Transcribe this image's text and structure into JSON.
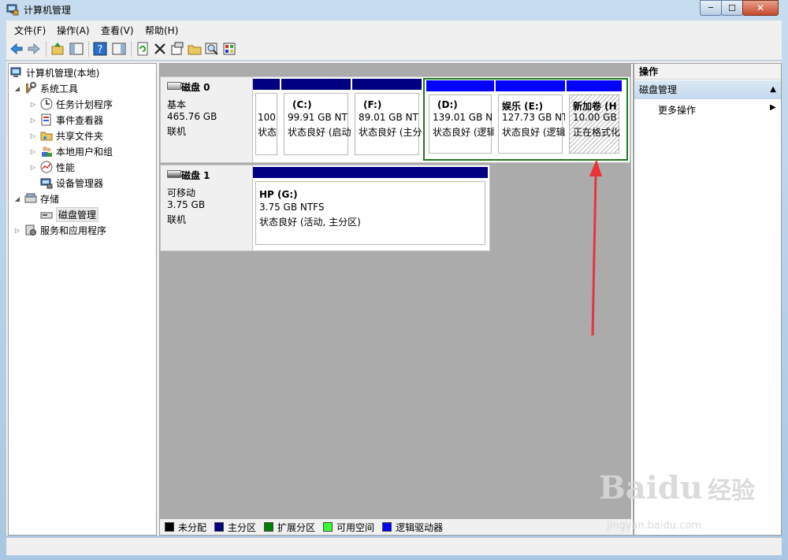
{
  "window": {
    "title": "计算机管理",
    "controls": {
      "minimize": "─",
      "maximize": "☐",
      "close": "✕"
    }
  },
  "menubar": {
    "items": [
      "文件(F)",
      "操作(A)",
      "查看(V)",
      "帮助(H)"
    ]
  },
  "toolbar": {
    "buttons": [
      "back-icon",
      "forward-icon",
      "up-icon",
      "show-tree-icon",
      "help-icon",
      "console-icon",
      "refresh-icon",
      "delete-icon",
      "properties-icon",
      "open-icon",
      "search-icon",
      "settings-icon"
    ]
  },
  "tree": {
    "root": "计算机管理(本地)",
    "system_tools": "系统工具",
    "task_scheduler": "任务计划程序",
    "event_viewer": "事件查看器",
    "shared_folders": "共享文件夹",
    "local_users": "本地用户和组",
    "performance": "性能",
    "device_manager": "设备管理器",
    "storage": "存储",
    "disk_management": "磁盘管理",
    "services_apps": "服务和应用程序"
  },
  "disks": [
    {
      "name": "磁盘 0",
      "type": "基本",
      "size": "465.76 GB",
      "status": "联机",
      "partitions": [
        {
          "label": "",
          "size": "100",
          "status": "状态",
          "kind": "primary"
        },
        {
          "label": "(C:)",
          "size": "99.91 GB NT",
          "status": "状态良好 (启动",
          "kind": "primary"
        },
        {
          "label": "(F:)",
          "size": "89.01 GB NT",
          "status": "状态良好 (主分",
          "kind": "primary"
        },
        {
          "label": "(D:)",
          "size": "139.01 GB N",
          "status": "状态良好 (逻辑",
          "kind": "logical"
        },
        {
          "label": "娱乐  (E:)",
          "size": "127.73 GB NT",
          "status": "状态良好 (逻辑",
          "kind": "logical"
        },
        {
          "label": "新加卷  (H",
          "size": "10.00 GB",
          "status": "正在格式化",
          "kind": "logical"
        }
      ]
    },
    {
      "name": "磁盘 1",
      "type": "可移动",
      "size": "3.75 GB",
      "status": "联机",
      "partitions": [
        {
          "label": "HP  (G:)",
          "size": "3.75 GB NTFS",
          "status": "状态良好 (活动, 主分区)",
          "kind": "primary"
        }
      ]
    }
  ],
  "legend": [
    {
      "label": "未分配",
      "color": "#000000"
    },
    {
      "label": "主分区",
      "color": "#000080"
    },
    {
      "label": "扩展分区",
      "color": "#008000"
    },
    {
      "label": "可用空间",
      "color": "#33ff33"
    },
    {
      "label": "逻辑驱动器",
      "color": "#0000ff"
    }
  ],
  "actions": {
    "header": "操作",
    "section": "磁盘管理",
    "more": "更多操作"
  },
  "watermark": {
    "brand": "Bai",
    "brand2": "du",
    "cn": "经验",
    "url": "jingyan.baidu.com"
  },
  "colors": {
    "primary": "#000080",
    "logical": "#0000ff",
    "extended": "#1f7a1f",
    "arrow": "#e8343a"
  }
}
